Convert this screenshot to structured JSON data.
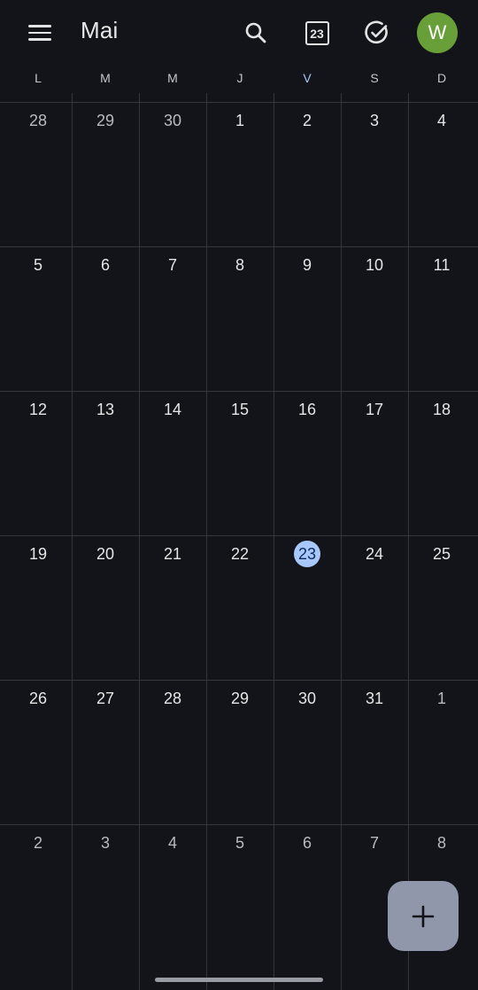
{
  "header": {
    "menu_icon": "hamburger-menu-icon",
    "month_title": "Mai",
    "search_icon": "search-icon",
    "today_button_date": "23",
    "tasks_icon": "check-circle-icon",
    "avatar_letter": "W",
    "avatar_color": "#689f38"
  },
  "weekdays": [
    "L",
    "M",
    "M",
    "J",
    "V",
    "S",
    "D"
  ],
  "today_weekday_index": 4,
  "weeks": [
    [
      {
        "d": "28",
        "muted": true
      },
      {
        "d": "29",
        "muted": true
      },
      {
        "d": "30",
        "muted": true
      },
      {
        "d": "1"
      },
      {
        "d": "2"
      },
      {
        "d": "3"
      },
      {
        "d": "4"
      }
    ],
    [
      {
        "d": "5"
      },
      {
        "d": "6"
      },
      {
        "d": "7"
      },
      {
        "d": "8"
      },
      {
        "d": "9"
      },
      {
        "d": "10"
      },
      {
        "d": "11"
      }
    ],
    [
      {
        "d": "12"
      },
      {
        "d": "13"
      },
      {
        "d": "14"
      },
      {
        "d": "15"
      },
      {
        "d": "16"
      },
      {
        "d": "17"
      },
      {
        "d": "18"
      }
    ],
    [
      {
        "d": "19"
      },
      {
        "d": "20"
      },
      {
        "d": "21"
      },
      {
        "d": "22"
      },
      {
        "d": "23",
        "today": true
      },
      {
        "d": "24"
      },
      {
        "d": "25"
      }
    ],
    [
      {
        "d": "26"
      },
      {
        "d": "27"
      },
      {
        "d": "28"
      },
      {
        "d": "29"
      },
      {
        "d": "30"
      },
      {
        "d": "31"
      },
      {
        "d": "1",
        "muted": true
      }
    ],
    [
      {
        "d": "2",
        "muted": true
      },
      {
        "d": "3",
        "muted": true
      },
      {
        "d": "4",
        "muted": true
      },
      {
        "d": "5",
        "muted": true
      },
      {
        "d": "6",
        "muted": true
      },
      {
        "d": "7",
        "muted": true
      },
      {
        "d": "8",
        "muted": true
      }
    ]
  ],
  "fab_icon": "plus-icon",
  "colors": {
    "background": "#131419",
    "today_highlight": "#a8c7fa",
    "fab": "#9097ab",
    "grid_lines": "#34363c"
  }
}
